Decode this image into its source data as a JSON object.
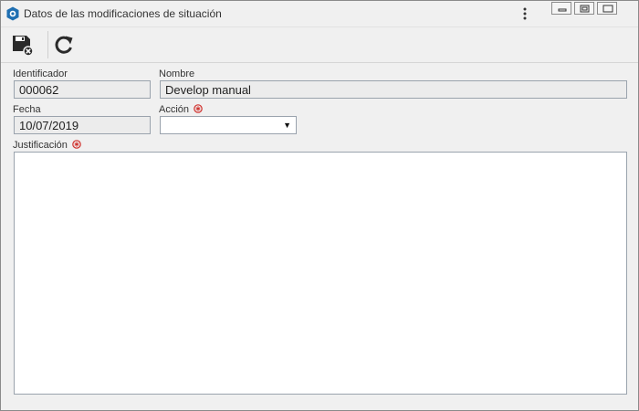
{
  "window": {
    "title": "Datos de las modificaciones de situación",
    "app_icon": "se-suite-icon",
    "controls": [
      "kebab-menu-icon",
      "minimize-icon",
      "restore-icon",
      "close-icon"
    ]
  },
  "toolbar": {
    "buttons": [
      "save-and-close-icon",
      "refresh-icon"
    ]
  },
  "form": {
    "identificador": {
      "label": "Identificador",
      "value": "000062"
    },
    "nombre": {
      "label": "Nombre",
      "value": "Develop manual"
    },
    "fecha": {
      "label": "Fecha",
      "value": "10/07/2019"
    },
    "accion": {
      "label": "Acción",
      "value": "",
      "required": true
    },
    "justificacion": {
      "label": "Justificación",
      "value": "",
      "required": true
    }
  },
  "colors": {
    "required_marker": "#d0312d",
    "read_only_field_bg": "#ececec",
    "window_bg": "#f0f0f0"
  }
}
